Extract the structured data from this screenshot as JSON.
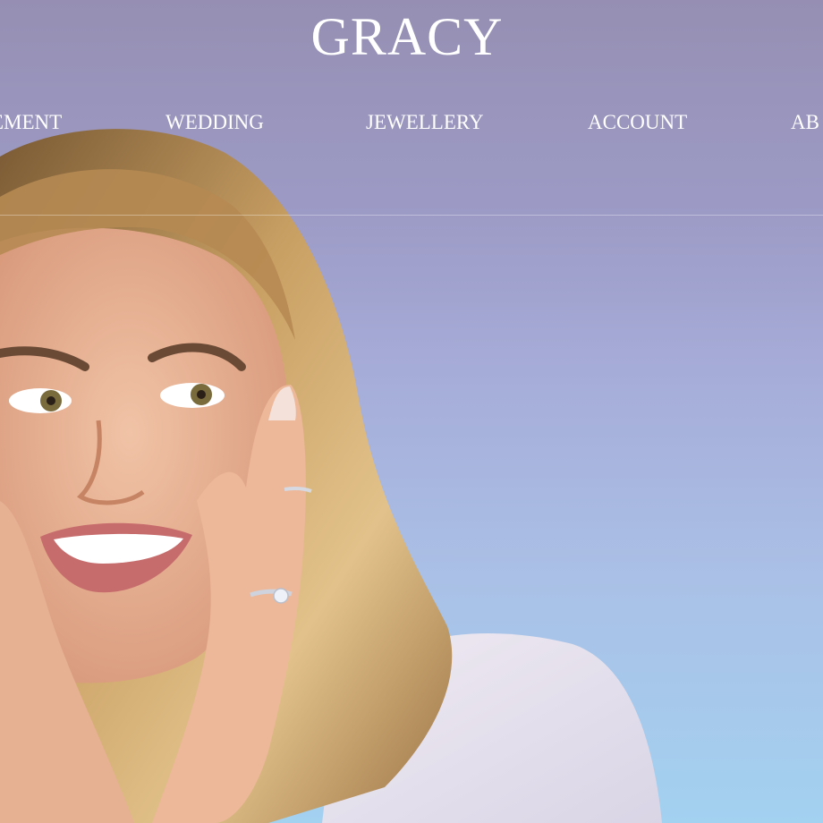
{
  "brand": {
    "logo": "GRACY"
  },
  "nav": {
    "items": [
      {
        "label": "EMENT"
      },
      {
        "label": "WEDDING"
      },
      {
        "label": "JEWELLERY"
      },
      {
        "label": "ACCOUNT"
      },
      {
        "label": "AB"
      }
    ]
  },
  "hero": {
    "image": "woman-smiling-wearing-diamond-rings",
    "colors": {
      "sky_top": "#968fb3",
      "sky_bottom": "#a3d1f0",
      "nav_text": "#ffffff"
    }
  }
}
